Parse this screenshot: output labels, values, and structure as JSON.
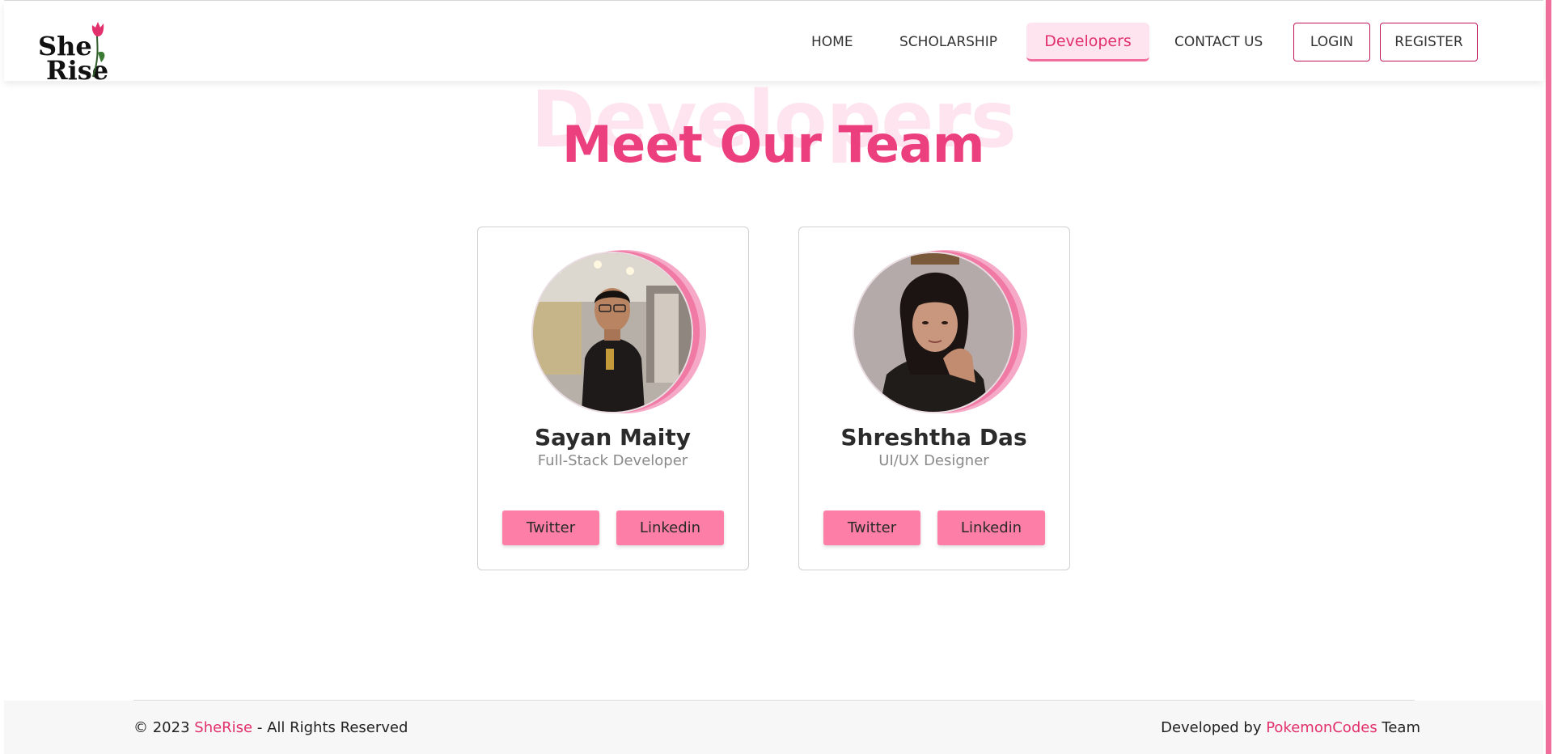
{
  "brand": {
    "line1": "She",
    "line2": "Rise"
  },
  "nav": {
    "home": "HOME",
    "scholarship": "SCHOLARSHIP",
    "developers": "Developers",
    "contact": "CONTACT US",
    "login": "LOGIN",
    "register": "REGISTER"
  },
  "hero": {
    "background_word": "Developers",
    "title": "Meet Our Team"
  },
  "team": [
    {
      "name": "Sayan Maity",
      "role": "Full-Stack Developer",
      "twitter": "Twitter",
      "linkedin": "Linkedin"
    },
    {
      "name": "Shreshtha Das",
      "role": "UI/UX Designer",
      "twitter": "Twitter",
      "linkedin": "Linkedin"
    }
  ],
  "footer": {
    "copyright_prefix": "© 2023 ",
    "brand": "SheRise",
    "copyright_suffix": " - All Rights Reserved",
    "dev_prefix": "Developed by ",
    "dev_team": "PokemonCodes",
    "dev_suffix": " Team"
  },
  "colors": {
    "accent": "#e1306c",
    "heading": "#ec3f7d",
    "button": "#fd7fa8",
    "active_tab_bg": "#fde4ee"
  }
}
